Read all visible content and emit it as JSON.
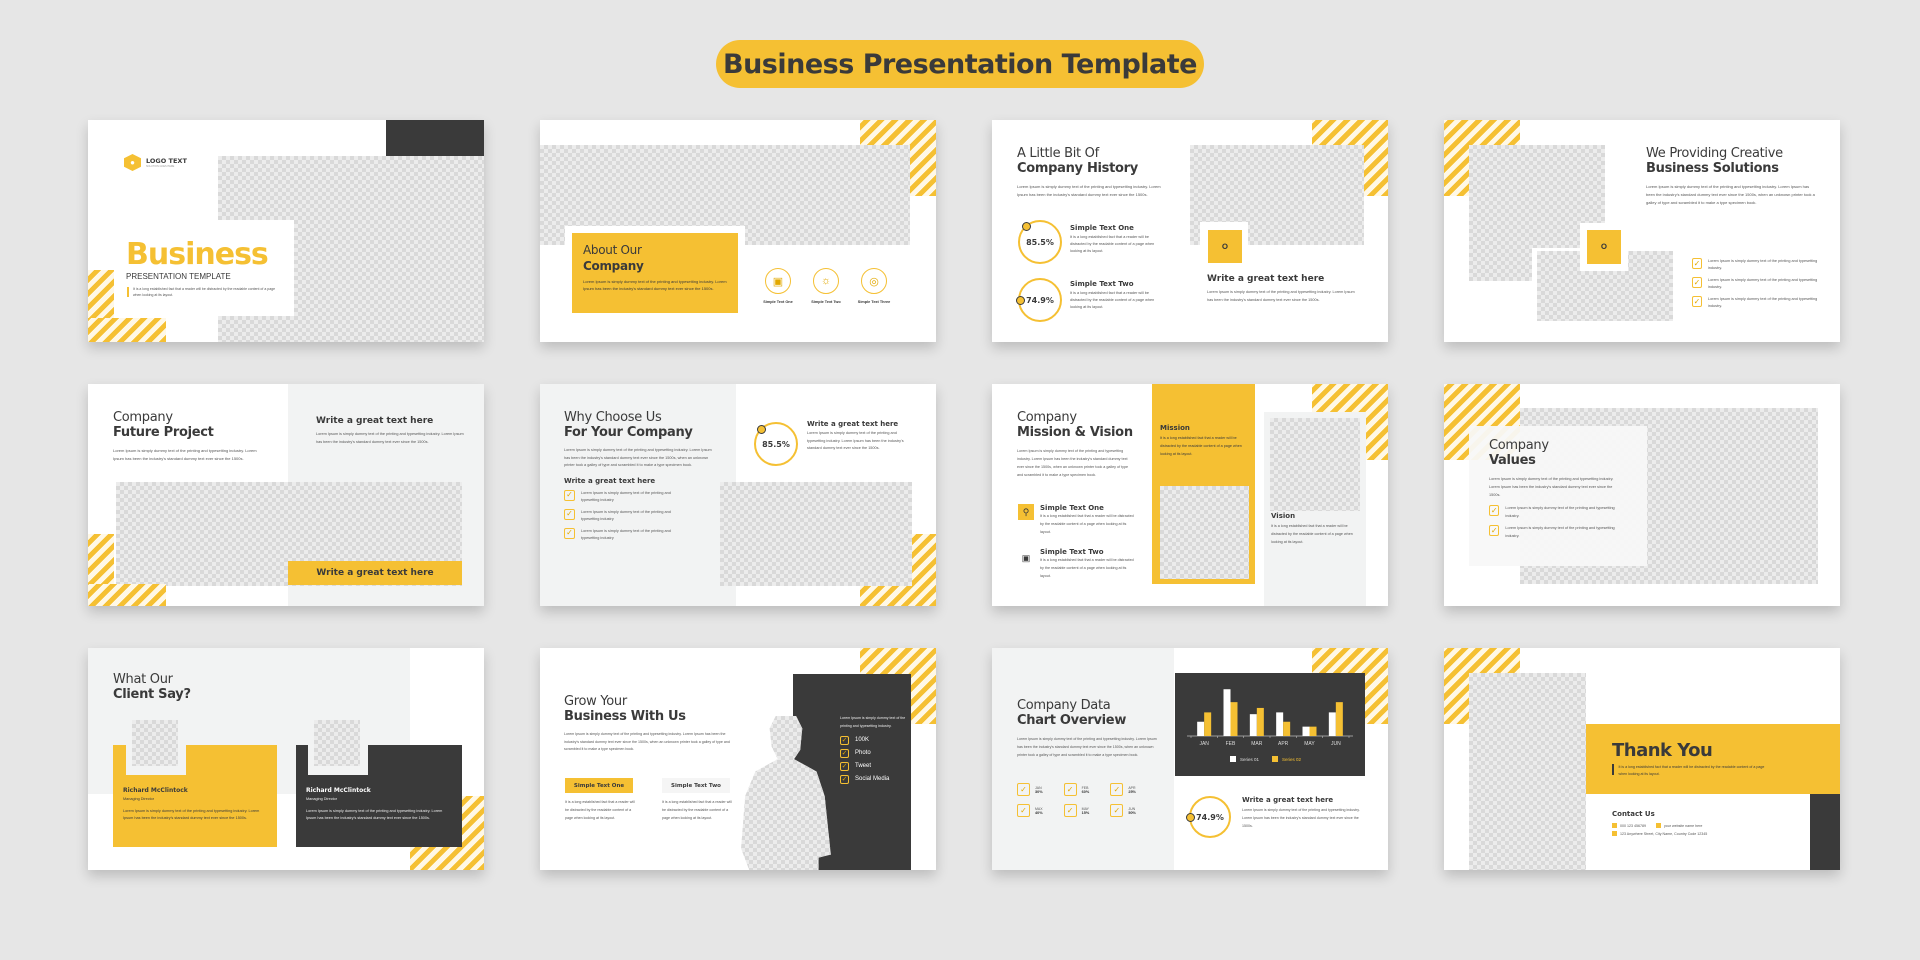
{
  "banner": {
    "title": "Business Presentation Template"
  },
  "colors": {
    "accent": "#f5c033",
    "dark": "#3a3a3a",
    "light_bg": "#f2f3f3",
    "page_bg": "#e6e6e6"
  },
  "slides": {
    "s1": {
      "logo_text": "LOGO TEXT",
      "logo_tagline": "SOLUTION GOES HERE",
      "logo_icon": "hexagon-flame-icon",
      "title": "Business",
      "subtitle": "PRESENTATION TEMPLATE",
      "body": "It is a long established fact that a reader will be distracted by the readable content of a page when looking at its layout."
    },
    "s2": {
      "title_thin": "About Our",
      "title_bold": "Company",
      "body": "Lorem Ipsum is simply dummy text of the printing and typesetting industry. Lorem Ipsum has been the industry's standard dummy text ever since the 1500s.",
      "icons": [
        {
          "icon": "monitor-chart-icon",
          "label": "Simple Text One"
        },
        {
          "icon": "lightbulb-icon",
          "label": "Simple Text Two"
        },
        {
          "icon": "target-icon",
          "label": "Simple Text Three"
        }
      ]
    },
    "s3": {
      "title_thin": "A Little Bit Of",
      "title_bold": "Company History",
      "body": "Lorem Ipsum is simply dummy text of the printing and typesetting industry. Lorem Ipsum has been the industry's standard dummy text ever since the 1500s.",
      "stats": [
        {
          "value": "85.5%",
          "title": "Simple Text One",
          "body": "It is a long established fact that a reader will be distracted by the readable content of a page when looking at its layout."
        },
        {
          "value": "74.9%",
          "title": "Simple Text Two",
          "body": "It is a long established fact that a reader will be distracted by the readable content of a page when looking at its layout."
        }
      ],
      "feature_title": "Write a great text here",
      "feature_body": "Lorem Ipsum is simply dummy text of the printing and typesetting industry. Lorem Ipsum has been the industry's standard dummy text ever since the 1500s."
    },
    "s4": {
      "title_thin": "We Providing Creative",
      "title_bold": "Business Solutions",
      "body": "Lorem Ipsum is simply dummy text of the printing and typesetting industry. Lorem Ipsum has been the industry's standard dummy text ever since the 1500s, when an unknown printer took a galley of type and scrambled it to make a type specimen book.",
      "checks": [
        "Lorem Ipsum is simply dummy text of the printing and typesetting industry.",
        "Lorem Ipsum is simply dummy text of the printing and typesetting industry.",
        "Lorem Ipsum is simply dummy text of the printing and typesetting industry."
      ]
    },
    "s5": {
      "title_thin": "Company",
      "title_bold": "Future Project",
      "body": "Lorem Ipsum is simply dummy text of the printing and typesetting industry. Lorem Ipsum has been the industry's standard dummy text ever since the 1500s.",
      "right_title": "Write a great text here",
      "right_body": "Lorem Ipsum is simply dummy text of the printing and typesetting industry. Lorem Ipsum has been the industry's standard dummy text ever since the 1500s.",
      "bar_label": "Write a great text here"
    },
    "s6": {
      "title_thin": "Why Choose Us",
      "title_bold": "For Your Company",
      "body": "Lorem Ipsum is simply dummy text of the printing and typesetting industry. Lorem Ipsum has been the industry's standard dummy text ever since the 1500s, when an unknown printer took a galley of type and scrambled it to make a type specimen book.",
      "list_title": "Write a great text here",
      "checks": [
        "Lorem Ipsum is simply dummy text of the printing and typesetting industry",
        "Lorem Ipsum is simply dummy text of the printing and typesetting industry",
        "Lorem Ipsum is simply dummy text of the printing and typesetting industry"
      ],
      "stat_value": "85.5%",
      "stat_title": "Write a great text here",
      "stat_body": "Lorem Ipsum is simply dummy text of the printing and typesetting industry. Lorem Ipsum has been the industry's standard dummy text ever since the 1500s."
    },
    "s7": {
      "title_thin": "Company",
      "title_bold": "Mission & Vision",
      "body": "Lorem Ipsum is simply dummy text of the printing and typesetting industry. Lorem Ipsum has been the industry's standard dummy text ever since the 1500s, when an unknown printer took a galley of type and scrambled it to make a type specimen book.",
      "items": [
        {
          "icon": "lightbulb-icon",
          "title": "Simple Text One",
          "body": "It is a long established fact that a reader will be distracted by the readable content of a page when looking at its layout."
        },
        {
          "icon": "briefcase-icon",
          "title": "Simple Text Two",
          "body": "It is a long established fact that a reader will be distracted by the readable content of a page when looking at its layout."
        }
      ],
      "mission_title": "Mission",
      "mission_body": "It is a long established fact that a reader will be distracted by the readable content of a page when looking at its layout.",
      "vision_title": "Vision",
      "vision_body": "It is a long established fact that a reader will be distracted by the readable content of a page when looking at its layout."
    },
    "s8": {
      "title_thin": "Company",
      "title_bold": "Values",
      "body": "Lorem Ipsum is simply dummy text of the printing and typesetting industry. Lorem Ipsum has been the industry's standard dummy text ever since the 1500s.",
      "checks": [
        "Lorem Ipsum is simply dummy text of the printing and typesetting industry.",
        "Lorem Ipsum is simply dummy text of the printing and typesetting industry."
      ]
    },
    "s9": {
      "title_thin": "What Our",
      "title_bold": "Client Say?",
      "cards": [
        {
          "name": "Richard McClintock",
          "role": "Managing Director",
          "body": "Lorem Ipsum is simply dummy text of the printing and typesetting industry. Lorem Ipsum has been the industry's standard dummy text ever since the 1500s."
        },
        {
          "name": "Richard McClintock",
          "role": "Managing Director",
          "body": "Lorem Ipsum is simply dummy text of the printing and typesetting industry. Lorem Ipsum has been the industry's standard dummy text ever since the 1500s."
        }
      ]
    },
    "s10": {
      "title_thin": "Grow Your",
      "title_bold": "Business With Us",
      "body": "Lorem Ipsum is simply dummy text of the printing and typesetting industry. Lorem Ipsum has been the industry's standard dummy text ever since the 1500s, when an unknown printer took a galley of type and scrambled it to make a type specimen book.",
      "col1_title": "Simple Text One",
      "col1_body": "It is a long established fact that a reader will be distracted by the readable content of a page when looking at its layout.",
      "col2_title": "Simple Text Two",
      "col2_body": "It is a long established fact that a reader will be distracted by the readable content of a page when looking at its layout.",
      "panel_body": "Lorem Ipsum is simply dummy text of the printing and typesetting industry.",
      "panel_checks": [
        "100K",
        "Photo",
        "Tweet",
        "Social Media"
      ]
    },
    "s11": {
      "title_thin": "Company Data",
      "title_bold": "Chart Overview",
      "body": "Lorem Ipsum is simply dummy text of the printing and typesetting industry. Lorem Ipsum has been the industry's standard dummy text ever since the 1500s, when an unknown printer took a galley of type and scrambled it to make a type specimen book.",
      "stats": [
        {
          "label": "JAN",
          "value": "30%"
        },
        {
          "label": "FEB",
          "value": "60%"
        },
        {
          "label": "APR",
          "value": "25%"
        },
        {
          "label": "MAX",
          "value": "40%"
        },
        {
          "label": "MAY",
          "value": "15%"
        },
        {
          "label": "JUN",
          "value": "50%"
        }
      ],
      "ring_value": "74.9%",
      "ring_title": "Write a great text here",
      "ring_body": "Lorem Ipsum is simply dummy text of the printing and typesetting industry. Lorem Ipsum has been the industry's standard dummy text ever since the 1500s."
    },
    "s12": {
      "title": "Thank You",
      "body": "It is a long established fact that a reader will be distracted by the readable content of a page when looking at its layout.",
      "contact_title": "Contact Us",
      "phone": "000 123 456789",
      "website": "your website name here",
      "address": "123 Anywhere Street, City Name, Country Code 12345"
    }
  },
  "chart_data": {
    "type": "bar",
    "title": "",
    "categories": [
      "JAN",
      "FEB",
      "MAR",
      "APR",
      "MAY",
      "JUN"
    ],
    "series": [
      {
        "name": "Series 01",
        "values": [
          3.2,
          10.5,
          4.9,
          5.3,
          2.1,
          5.3
        ],
        "color": "#ffffff"
      },
      {
        "name": "Series 02",
        "values": [
          5.3,
          7.6,
          6.3,
          3.2,
          2.1,
          7.6
        ],
        "color": "#f5c033"
      }
    ],
    "ylim": [
      0,
      11
    ],
    "xlabel": "",
    "ylabel": "",
    "grid": false,
    "legend": "bottom"
  }
}
